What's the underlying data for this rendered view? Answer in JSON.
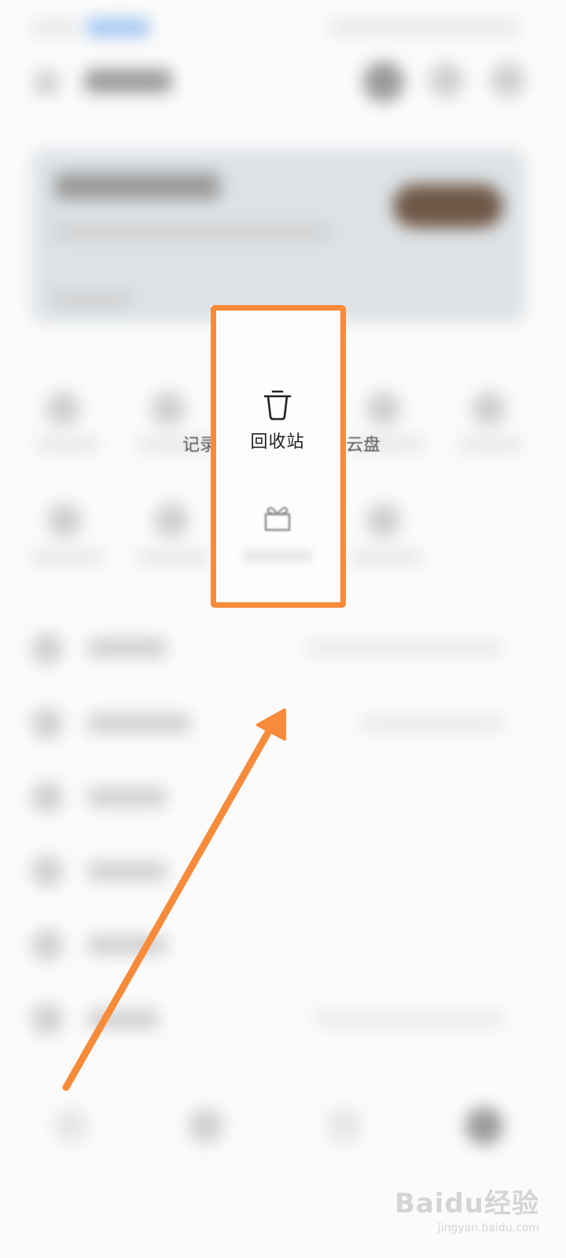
{
  "focus": {
    "recycle_label": "回收站",
    "recycle_icon": "trash-icon",
    "gift_icon": "gift-icon"
  },
  "partial_labels": {
    "left_fragment": "记录",
    "right_fragment": "云盘"
  },
  "annotation": {
    "frame_color": "#f78b3a",
    "arrow_color": "#f78b3a"
  },
  "watermark": {
    "brand": "Baidu经验",
    "domain": "jingyan.baidu.com"
  }
}
